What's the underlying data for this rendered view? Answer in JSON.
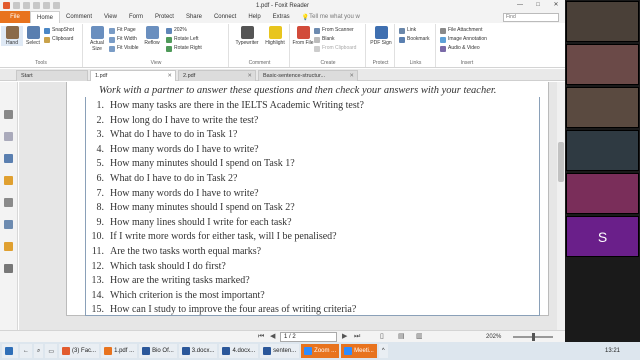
{
  "window": {
    "title": "1.pdf - Foxit Reader",
    "minimize": "—",
    "maximize": "□",
    "close": "✕"
  },
  "ribbon_tabs": [
    "File",
    "Home",
    "Comment",
    "View",
    "Form",
    "Protect",
    "Share",
    "Connect",
    "Help",
    "Extras"
  ],
  "tell_me": "Tell me what you w",
  "find_placeholder": "Find",
  "ribbon": {
    "tools": {
      "label": "Tools",
      "hand": "Hand",
      "select": "Select",
      "snapshot": "SnapShot",
      "clipboard": "Clipboard"
    },
    "view": {
      "label": "View",
      "actual_size": "Actual Size",
      "fit_page": "Fit Page",
      "fit_width": "Fit Width",
      "fit_visible": "Fit Visible",
      "reflow": "Reflow",
      "zoom": "202%",
      "rotate_left": "Rotate Left",
      "rotate_right": "Rotate Right"
    },
    "comment": {
      "label": "Comment",
      "typewriter": "Typewriter",
      "highlight": "Highlight"
    },
    "create": {
      "label": "Create",
      "from_file": "From File",
      "from_scanner": "From Scanner",
      "blank": "Blank",
      "from_clipboard": "From Clipboard"
    },
    "protect": {
      "label": "Protect",
      "pdf_sign": "PDF Sign"
    },
    "links": {
      "label": "Links",
      "link": "Link",
      "bookmark": "Bookmark"
    },
    "insert": {
      "label": "Insert",
      "file_attachment": "File Attachment",
      "image_annotation": "Image Annotation",
      "audio_video": "Audio & Video"
    }
  },
  "doc_tabs": [
    {
      "label": "Start"
    },
    {
      "label": "1.pdf"
    },
    {
      "label": "2.pdf"
    },
    {
      "label": "Basic-sentence-structur..."
    }
  ],
  "document": {
    "heading": "Work with a partner to answer these questions and then check your answers with your teacher.",
    "questions": [
      {
        "num": "1.",
        "text": "How many tasks are there in the IELTS Academic Writing test?"
      },
      {
        "num": "2.",
        "text": "How long do I have to write the test?"
      },
      {
        "num": "3.",
        "text": "What do I have to do in Task 1?"
      },
      {
        "num": "4.",
        "text": "How many words do I have to write?"
      },
      {
        "num": "5.",
        "text": "How many minutes should I spend on Task 1?"
      },
      {
        "num": "6.",
        "text": "What do I have to do in Task 2?"
      },
      {
        "num": "7.",
        "text": "How many words do I have to write?"
      },
      {
        "num": "8.",
        "text": "How many minutes should I spend on Task 2?"
      },
      {
        "num": "9.",
        "text": "How many lines should I write for each task?"
      },
      {
        "num": "10.",
        "text": "If I write more words for either task, will I be penalised?"
      },
      {
        "num": "11.",
        "text": "Are the two tasks worth equal marks?"
      },
      {
        "num": "12.",
        "text": "Which task should I do first?"
      },
      {
        "num": "13.",
        "text": "How are the writing tasks marked?"
      },
      {
        "num": "14.",
        "text": "Which criterion is the most important?"
      },
      {
        "num": "15.",
        "text": "How can I study to improve the four areas of writing criteria?"
      }
    ]
  },
  "status": {
    "page": "1 / 2",
    "zoom": "202%"
  },
  "taskbar": {
    "items": [
      "(3) Fac...",
      "1.pdf ...",
      "Bio Of...",
      "3.docx...",
      "4.docx...",
      "senten...",
      "Zoom ...",
      "Meeti..."
    ],
    "time": "13:21"
  },
  "video": {
    "initial": "S"
  }
}
